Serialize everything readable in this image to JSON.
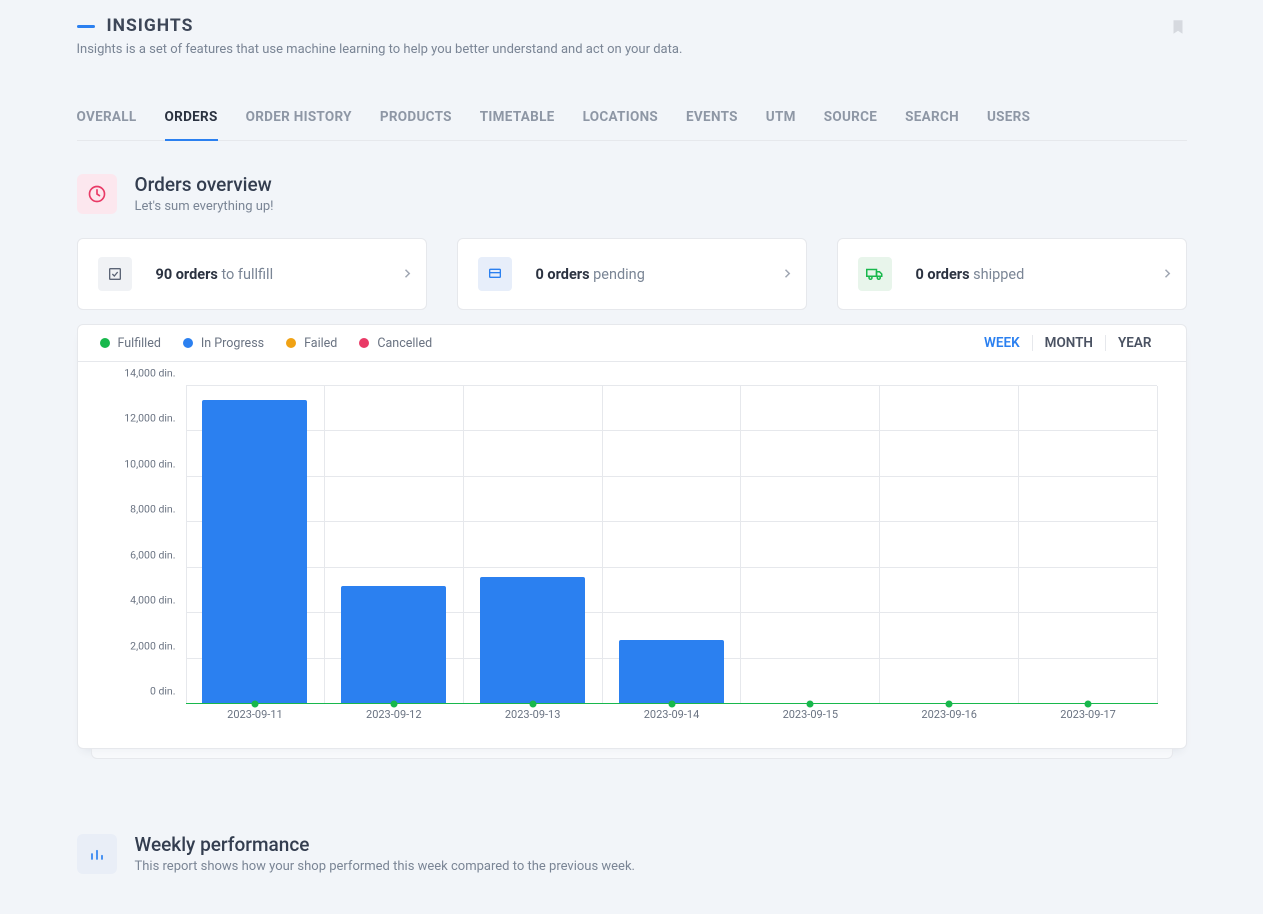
{
  "header": {
    "title": "INSIGHTS",
    "subtitle": "Insights is a set of features that use machine learning to help you better understand and act on your data."
  },
  "tabs": [
    {
      "label": "Overall",
      "active": false
    },
    {
      "label": "Orders",
      "active": true
    },
    {
      "label": "Order history",
      "active": false
    },
    {
      "label": "Products",
      "active": false
    },
    {
      "label": "Timetable",
      "active": false
    },
    {
      "label": "Locations",
      "active": false
    },
    {
      "label": "Events",
      "active": false
    },
    {
      "label": "UTM",
      "active": false
    },
    {
      "label": "Source",
      "active": false
    },
    {
      "label": "Search",
      "active": false
    },
    {
      "label": "Users",
      "active": false
    }
  ],
  "overview": {
    "title": "Orders overview",
    "subtitle": "Let's sum everything up!",
    "cards": [
      {
        "bold": "90 orders",
        "rest": " to fullfill"
      },
      {
        "bold": "0 orders",
        "rest": " pending"
      },
      {
        "bold": "0 orders",
        "rest": " shipped"
      }
    ]
  },
  "legend": [
    {
      "label": "Fulfilled",
      "color": "#18b84c"
    },
    {
      "label": "In Progress",
      "color": "#2b80f0"
    },
    {
      "label": "Failed",
      "color": "#f0a214"
    },
    {
      "label": "Cancelled",
      "color": "#e93a66"
    }
  ],
  "periods": [
    {
      "label": "WEEK",
      "active": true
    },
    {
      "label": "MONTH",
      "active": false
    },
    {
      "label": "YEAR",
      "active": false
    }
  ],
  "chart_data": {
    "type": "bar",
    "categories": [
      "2023-09-11",
      "2023-09-12",
      "2023-09-13",
      "2023-09-14",
      "2023-09-15",
      "2023-09-16",
      "2023-09-17"
    ],
    "series": [
      {
        "name": "In Progress",
        "values": [
          13400,
          5200,
          5600,
          2800,
          0,
          0,
          0
        ]
      },
      {
        "name": "Fulfilled",
        "values": [
          0,
          0,
          0,
          0,
          0,
          0,
          0
        ]
      },
      {
        "name": "Failed",
        "values": [
          0,
          0,
          0,
          0,
          0,
          0,
          0
        ]
      },
      {
        "name": "Cancelled",
        "values": [
          0,
          0,
          0,
          0,
          0,
          0,
          0
        ]
      }
    ],
    "y_ticks": [
      0,
      2000,
      4000,
      6000,
      8000,
      10000,
      12000,
      14000
    ],
    "y_tick_labels": [
      "0 din.",
      "2,000 din.",
      "4,000 din.",
      "6,000 din.",
      "8,000 din.",
      "10,000 din.",
      "12,000 din.",
      "14,000 din."
    ],
    "ylim": [
      0,
      14000
    ],
    "unit": "din.",
    "title": "",
    "xlabel": "",
    "ylabel": ""
  },
  "weekly": {
    "title": "Weekly performance",
    "subtitle": "This report shows how your shop performed this week compared to the previous week."
  }
}
